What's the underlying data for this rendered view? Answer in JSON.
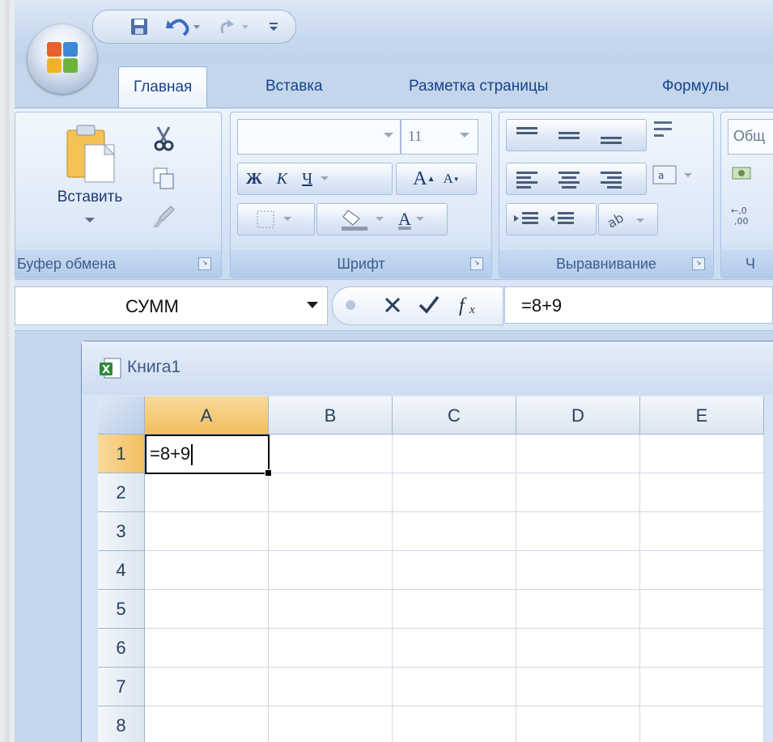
{
  "quick_access": {
    "save": "save",
    "undo": "undo",
    "redo": "redo"
  },
  "tabs": [
    {
      "label": "Главная",
      "active": true
    },
    {
      "label": "Вставка",
      "active": false
    },
    {
      "label": "Разметка страницы",
      "active": false
    },
    {
      "label": "Формулы",
      "active": false
    }
  ],
  "ribbon": {
    "clipboard": {
      "label": "Буфер обмена",
      "paste_label": "Вставить"
    },
    "font": {
      "label": "Шрифт",
      "font_size": "11",
      "bold": "Ж",
      "italic": "К",
      "underline": "Ч",
      "grow": "A",
      "shrink": "A",
      "font_color": "A"
    },
    "alignment": {
      "label": "Выравнивание"
    },
    "number": {
      "label_partial": "Ч",
      "format_partial": "Общ"
    }
  },
  "formula_bar": {
    "name_box": "СУММ",
    "fx_label": "fx",
    "content": "=8+9"
  },
  "workbook": {
    "title": "Книга1",
    "columns": [
      "A",
      "B",
      "C",
      "D",
      "E"
    ],
    "rows": [
      "1",
      "2",
      "3",
      "4",
      "5",
      "6",
      "7",
      "8"
    ],
    "active_cell": {
      "column": "A",
      "row": "1",
      "value": "=8+9"
    }
  },
  "colors": {
    "selected_header": "#f1bf5f",
    "tab_text": "#15428b",
    "ribbon": "#dbe7f6"
  }
}
